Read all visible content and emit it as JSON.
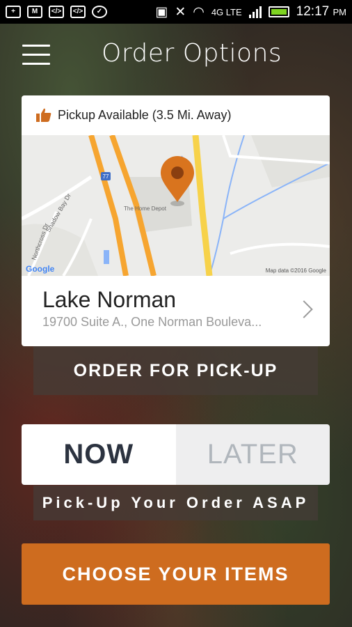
{
  "status": {
    "time": "12:17",
    "ampm": "PM",
    "network": "4G LTE"
  },
  "header": {
    "title": "Order Options"
  },
  "location_card": {
    "pickup_label": "Pickup Available (3.5 Mi. Away)",
    "map": {
      "store_label": "The Home Depot",
      "road_label_1": "Shadow Bay Dr",
      "road_label_2": "Northcross Dr",
      "highway_label": "77",
      "attribution": "Map data ©2016 Google",
      "google": "Google"
    },
    "name": "Lake Norman",
    "address": "19700 Suite A., One Norman Bouleva..."
  },
  "actions": {
    "order_pickup": "ORDER FOR PICK-UP",
    "now": "NOW",
    "later": "LATER",
    "asap_note": "Pick-Up Your Order ASAP",
    "choose_items": "CHOOSE YOUR ITEMS"
  },
  "colors": {
    "accent": "#ce6c1f",
    "pin": "#d9741e",
    "highway_yellow": "#f7d24a",
    "highway_orange": "#f6a530"
  }
}
